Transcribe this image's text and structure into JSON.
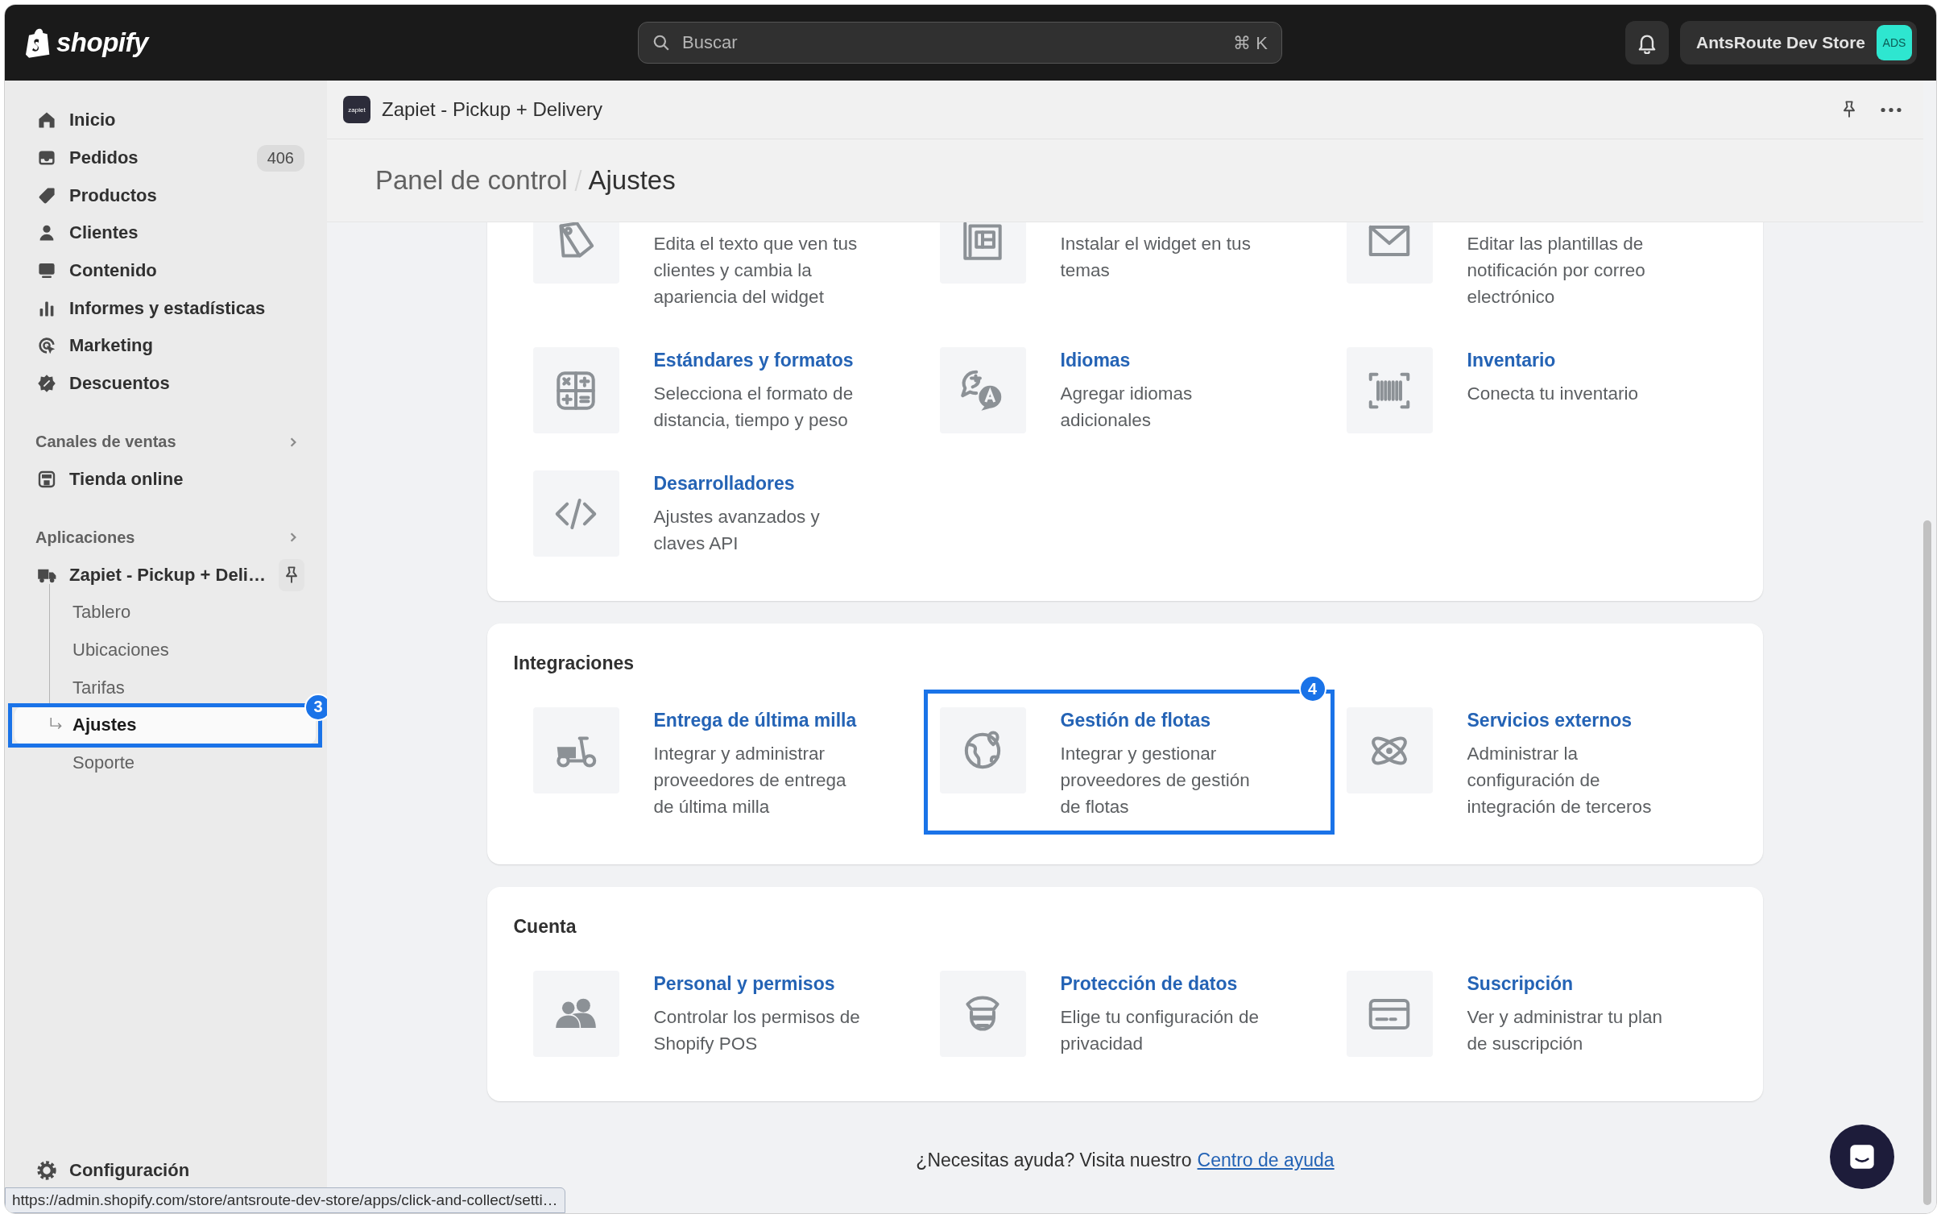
{
  "topbar": {
    "logo": "shopify",
    "search": {
      "placeholder": "Buscar",
      "shortcut": "⌘ K"
    },
    "store": {
      "name": "AntsRoute Dev Store",
      "avatar": "ADS"
    }
  },
  "sidebar": {
    "items": [
      {
        "label": "Inicio",
        "selected": false
      },
      {
        "label": "Pedidos",
        "selected": false,
        "badge": "406"
      },
      {
        "label": "Productos",
        "selected": false
      },
      {
        "label": "Clientes",
        "selected": false
      },
      {
        "label": "Contenido",
        "selected": false
      },
      {
        "label": "Informes y estadísticas",
        "selected": false
      },
      {
        "label": "Marketing",
        "selected": false
      },
      {
        "label": "Descuentos",
        "selected": false
      }
    ],
    "sections": [
      {
        "title": "Canales de ventas",
        "items": [
          {
            "label": "Tienda online",
            "selected": false
          }
        ]
      },
      {
        "title": "Aplicaciones",
        "items": [
          {
            "label": "Zapiet - Pickup + Deli…",
            "selected": false,
            "children": [
              {
                "label": "Tablero",
                "selected": false
              },
              {
                "label": "Ubicaciones",
                "selected": false
              },
              {
                "label": "Tarifas",
                "selected": false
              },
              {
                "label": "Ajustes",
                "selected": true,
                "callout": "3"
              },
              {
                "label": "Soporte",
                "selected": false
              }
            ]
          }
        ]
      }
    ],
    "footer": {
      "label": "Configuración"
    }
  },
  "app_header": {
    "logo": "zapiet",
    "title": "Zapiet - Pickup + Delivery"
  },
  "breadcrumb": [
    "Panel de control",
    "Ajustes"
  ],
  "cards": [
    {
      "items": [
        {
          "description": "Edita el texto que ven tus clientes y cambia la apariencia del widget"
        },
        {
          "description": "Instalar el widget en tus temas"
        },
        {
          "description": "Editar las plantillas de notificación por correo electrónico"
        },
        {
          "title": "Estándares y formatos",
          "description": "Selecciona el formato de distancia, tiempo y peso"
        },
        {
          "title": "Idiomas",
          "description": "Agregar idiomas adicionales"
        },
        {
          "title": "Inventario",
          "description": "Conecta tu inventario"
        },
        {
          "title": "Desarrolladores",
          "description": "Ajustes avanzados y claves API"
        }
      ]
    },
    {
      "heading": "Integraciones",
      "items": [
        {
          "title": "Entrega de última milla",
          "description": "Integrar y administrar proveedores de entrega de última milla"
        },
        {
          "title": "Gestión de flotas",
          "description": "Integrar y gestionar proveedores de gestión de flotas",
          "callout": "4"
        },
        {
          "title": "Servicios externos",
          "description": "Administrar la configuración de integración de terceros"
        }
      ]
    },
    {
      "heading": "Cuenta",
      "items": [
        {
          "title": "Personal y permisos",
          "description": "Controlar los permisos de Shopify POS"
        },
        {
          "title": "Protección de datos",
          "description": "Elige tu configuración de privacidad"
        },
        {
          "title": "Suscripción",
          "description": "Ver y administrar tu plan de suscripción"
        }
      ]
    }
  ],
  "help": {
    "text": "¿Necesitas ayuda? Visita nuestro",
    "link": "Centro de ayuda"
  },
  "status_url": "https://admin.shopify.com/store/antsroute-dev-store/apps/click-and-collect/setti…"
}
